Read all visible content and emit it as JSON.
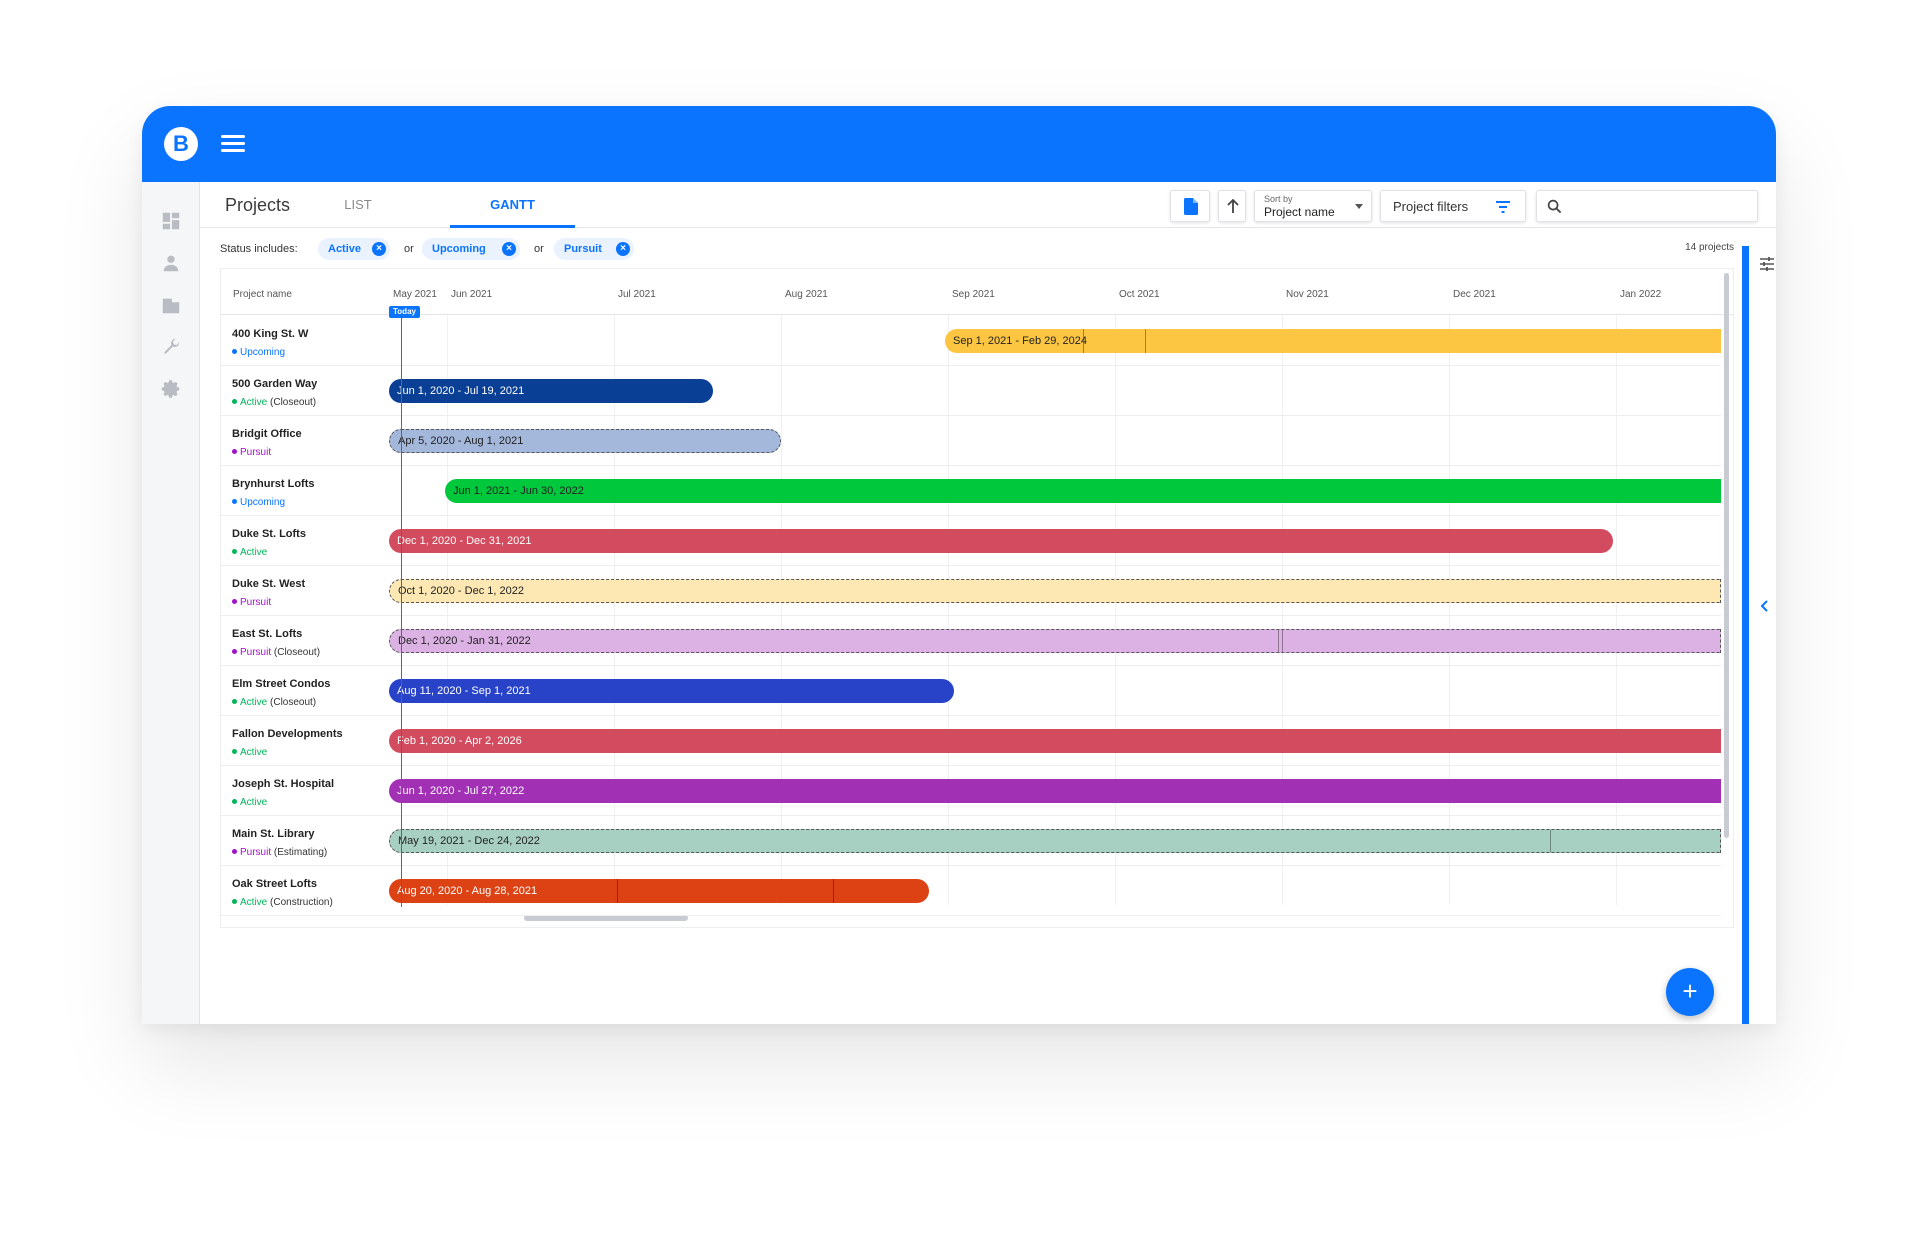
{
  "app": {
    "logo_letter": "B",
    "brand_color": "#0a74ff"
  },
  "header": {
    "title": "Projects",
    "tabs": [
      {
        "label": "LIST"
      },
      {
        "label": "GANTT"
      }
    ],
    "active_tab": "GANTT"
  },
  "toolbar": {
    "sort_label": "Sort by",
    "sort_value": "Project name",
    "filters_label": "Project filters",
    "search_placeholder": ""
  },
  "filters": {
    "label": "Status includes:",
    "chips": [
      {
        "label": "Active"
      },
      {
        "label": "Upcoming"
      },
      {
        "label": "Pursuit"
      }
    ],
    "joiner": "or"
  },
  "project_count": "14 projects",
  "gantt": {
    "name_header": "Project name",
    "months": [
      "May 2021",
      "Jun 2021",
      "Jul 2021",
      "Aug 2021",
      "Sep 2021",
      "Oct 2021",
      "Nov 2021",
      "Dec 2021",
      "Jan 2022"
    ],
    "today_label": "Today",
    "projects": [
      {
        "name": "400 King St. W",
        "status": "Upcoming",
        "phase": "",
        "dates": "Sep 1, 2021 - Feb 29, 2024",
        "color": "#fcc642"
      },
      {
        "name": "500 Garden Way",
        "status": "Active",
        "phase": "(Closeout)",
        "dates": "Jun 1, 2020 - Jul 19, 2021",
        "color": "#0a3f96"
      },
      {
        "name": "Bridgit Office",
        "status": "Pursuit",
        "phase": "",
        "dates": "Apr 5, 2020 - Aug 1, 2021",
        "color": "#a4b8dc"
      },
      {
        "name": "Brynhurst Lofts",
        "status": "Upcoming",
        "phase": "",
        "dates": "Jun 1, 2021 - Jun 30, 2022",
        "color": "#00c83c"
      },
      {
        "name": "Duke St. Lofts",
        "status": "Active",
        "phase": "",
        "dates": "Dec 1, 2020 - Dec 31, 2021",
        "color": "#d24b5e"
      },
      {
        "name": "Duke St. West",
        "status": "Pursuit",
        "phase": "",
        "dates": "Oct 1, 2020 - Dec 1, 2022",
        "color": "#fde8b4"
      },
      {
        "name": "East St. Lofts",
        "status": "Pursuit",
        "phase": "(Closeout)",
        "dates": "Dec 1, 2020 - Jan 31, 2022",
        "color": "#dcb2e4"
      },
      {
        "name": "Elm Street Condos",
        "status": "Active",
        "phase": "(Closeout)",
        "dates": "Aug 11, 2020 - Sep 1, 2021",
        "color": "#2843c8"
      },
      {
        "name": "Fallon Developments",
        "status": "Active",
        "phase": "",
        "dates": "Feb 1, 2020 - Apr 2, 2026",
        "color": "#d24b5e"
      },
      {
        "name": "Joseph St. Hospital",
        "status": "Active",
        "phase": "",
        "dates": "Jun 1, 2020 - Jul 27, 2022",
        "color": "#a230b4"
      },
      {
        "name": "Main St. Library",
        "status": "Pursuit",
        "phase": "(Estimating)",
        "dates": "May 19, 2021 - Dec 24, 2022",
        "color": "#a8d0c2"
      },
      {
        "name": "Oak Street Lofts",
        "status": "Active",
        "phase": "(Construction)",
        "dates": "Aug 20, 2020 - Aug 28, 2021",
        "color": "#dc4214"
      }
    ]
  },
  "status_colors": {
    "Active": "#00b45a",
    "Upcoming": "#0a74ff",
    "Pursuit": "#a012c8"
  }
}
